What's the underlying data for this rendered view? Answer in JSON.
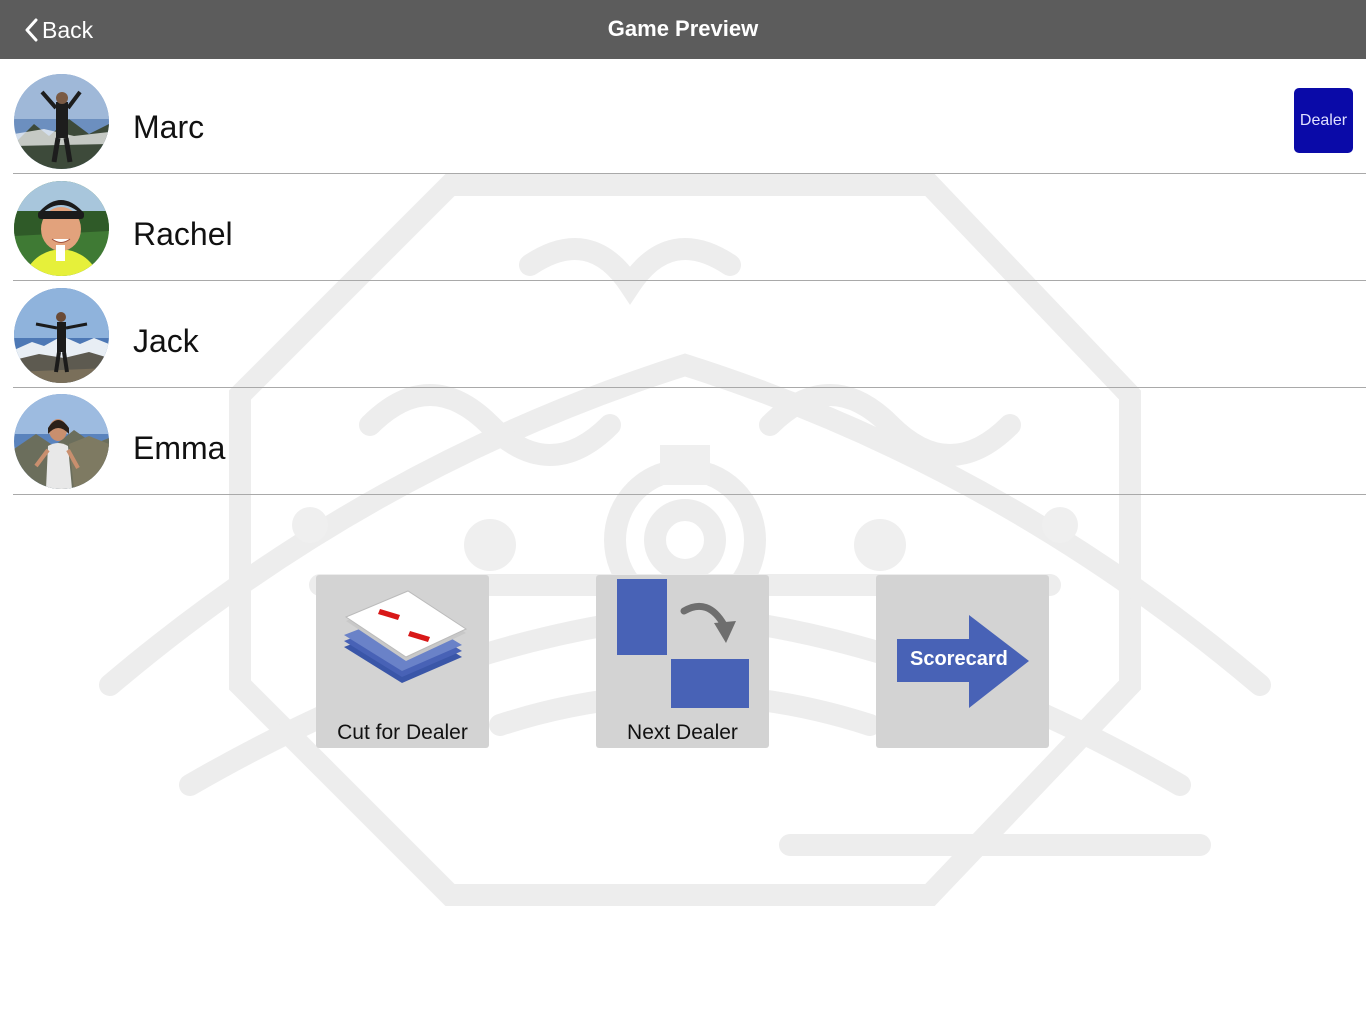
{
  "navbar": {
    "back_label": "Back",
    "title": "Game Preview"
  },
  "players": [
    {
      "name": "Marc",
      "is_dealer": true
    },
    {
      "name": "Rachel",
      "is_dealer": false
    },
    {
      "name": "Jack",
      "is_dealer": false
    },
    {
      "name": "Emma",
      "is_dealer": false
    }
  ],
  "dealer_badge_label": "Dealer",
  "actions": {
    "cut_for_dealer_label": "Cut for Dealer",
    "next_dealer_label": "Next Dealer",
    "scorecard_label": "Scorecard"
  },
  "colors": {
    "navbar_bg": "#5c5c5c",
    "dealer_badge_bg": "#0a0aa8",
    "card_blue": "#4862b6",
    "button_bg": "#d3d3d3"
  }
}
